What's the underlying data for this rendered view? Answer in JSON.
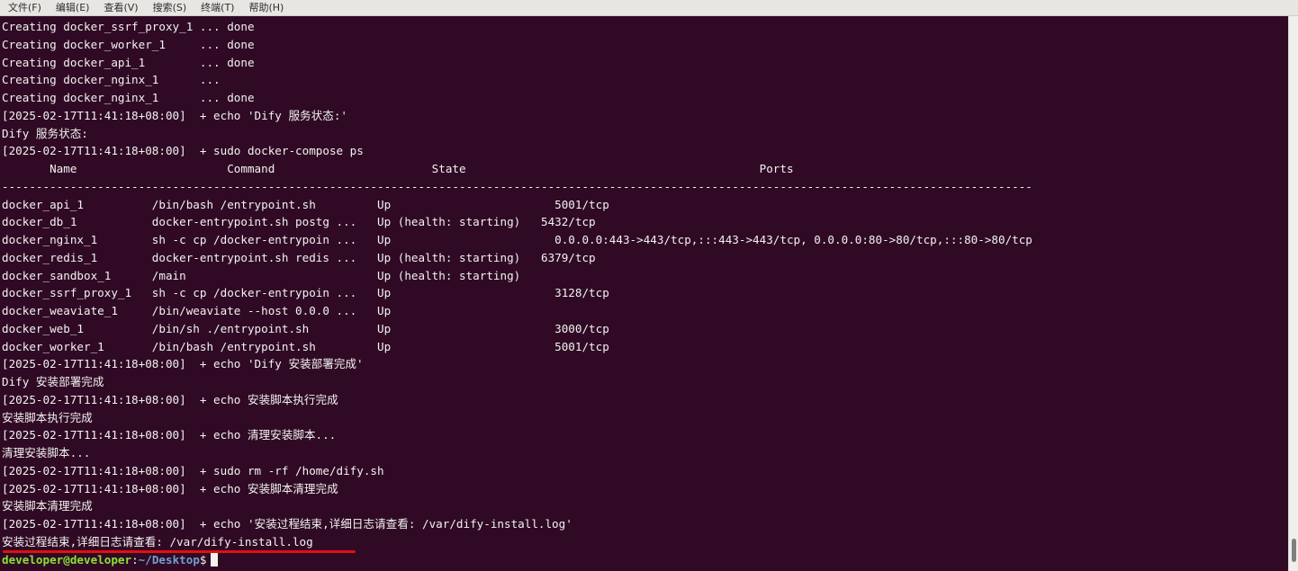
{
  "menubar": {
    "items": [
      "文件(F)",
      "编辑(E)",
      "查看(V)",
      "搜索(S)",
      "终端(T)",
      "帮助(H)"
    ]
  },
  "terminal": {
    "lines": [
      "Creating docker_ssrf_proxy_1 ... done",
      "Creating docker_worker_1     ... done",
      "Creating docker_api_1        ... done",
      "Creating docker_nginx_1      ...",
      "Creating docker_nginx_1      ... done",
      "[2025-02-17T11:41:18+08:00]  + echo 'Dify 服务状态:'",
      "Dify 服务状态:",
      "[2025-02-17T11:41:18+08:00]  + sudo docker-compose ps",
      "       Name                      Command                       State                                           Ports",
      "-------------------------------------------------------------------------------------------------------------------------------------------------------",
      "docker_api_1          /bin/bash /entrypoint.sh         Up                        5001/tcp",
      "docker_db_1           docker-entrypoint.sh postg ...   Up (health: starting)   5432/tcp",
      "docker_nginx_1        sh -c cp /docker-entrypoin ...   Up                        0.0.0.0:443->443/tcp,:::443->443/tcp, 0.0.0.0:80->80/tcp,:::80->80/tcp",
      "docker_redis_1        docker-entrypoint.sh redis ...   Up (health: starting)   6379/tcp",
      "docker_sandbox_1      /main                            Up (health: starting)",
      "docker_ssrf_proxy_1   sh -c cp /docker-entrypoin ...   Up                        3128/tcp",
      "docker_weaviate_1     /bin/weaviate --host 0.0.0 ...   Up",
      "docker_web_1          /bin/sh ./entrypoint.sh          Up                        3000/tcp",
      "docker_worker_1       /bin/bash /entrypoint.sh         Up                        5001/tcp",
      "[2025-02-17T11:41:18+08:00]  + echo 'Dify 安装部署完成'",
      "Dify 安装部署完成",
      "[2025-02-17T11:41:18+08:00]  + echo 安装脚本执行完成",
      "安装脚本执行完成",
      "[2025-02-17T11:41:18+08:00]  + echo 清理安装脚本...",
      "清理安装脚本...",
      "[2025-02-17T11:41:18+08:00]  + sudo rm -rf /home/dify.sh",
      "[2025-02-17T11:41:18+08:00]  + echo 安装脚本清理完成",
      "安装脚本清理完成",
      "[2025-02-17T11:41:18+08:00]  + echo '安装过程结束,详细日志请查看: /var/dify-install.log'",
      "安装过程结束,详细日志请查看: /var/dify-install.log"
    ],
    "prompt": {
      "user_host": "developer@developer",
      "colon": ":",
      "path": "~/Desktop",
      "symbol": "$"
    }
  },
  "colors": {
    "background": "#300a24",
    "text": "#f2f2f2",
    "prompt_user": "#8ae234",
    "prompt_path": "#729fcf",
    "annotation": "#e01010"
  }
}
